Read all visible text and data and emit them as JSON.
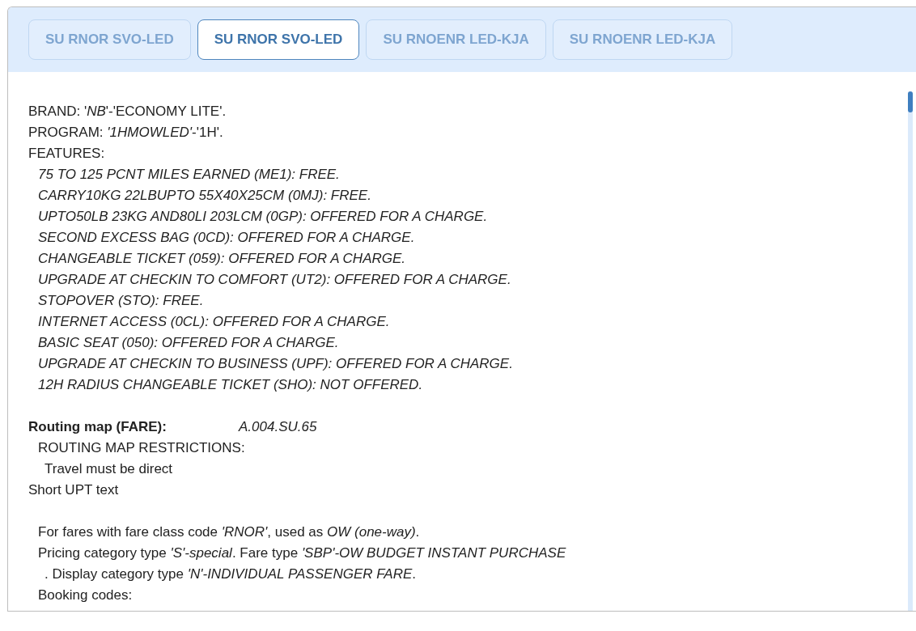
{
  "tabs": [
    {
      "label": "SU RNOR SVO-LED",
      "selected": false
    },
    {
      "label": "SU RNOR SVO-LED",
      "selected": true
    },
    {
      "label": "SU RNOENR LED-KJA",
      "selected": false
    },
    {
      "label": "SU RNOENR LED-KJA",
      "selected": false
    }
  ],
  "sections": [
    {
      "lines": [
        {
          "kind": "top",
          "text": "BRAND: '*NB*'-'ECONOMY LITE'."
        },
        {
          "kind": "top",
          "text": "PROGRAM: *'1HMOWLED'*-'1H'."
        },
        {
          "kind": "top",
          "text": "FEATURES:"
        },
        {
          "kind": "feature",
          "text": "75 TO 125 PCNT MILES EARNED (ME1): FREE."
        },
        {
          "kind": "feature",
          "text": "CARRY10KG 22LBUPTO 55X40X25CM (0MJ): FREE."
        },
        {
          "kind": "feature",
          "text": "UPTO50LB 23KG AND80LI 203LCM (0GP): OFFERED FOR A CHARGE."
        },
        {
          "kind": "feature",
          "text": "SECOND EXCESS BAG (0CD): OFFERED FOR A CHARGE."
        },
        {
          "kind": "feature",
          "text": "CHANGEABLE TICKET (059): OFFERED FOR A CHARGE."
        },
        {
          "kind": "feature",
          "text": "UPGRADE AT CHECKIN TO COMFORT (UT2): OFFERED FOR A CHARGE."
        },
        {
          "kind": "feature",
          "text": "STOPOVER (STO): FREE."
        },
        {
          "kind": "feature",
          "text": "INTERNET ACCESS (0CL): OFFERED FOR A CHARGE."
        },
        {
          "kind": "feature",
          "text": "BASIC SEAT (050): OFFERED FOR A CHARGE."
        },
        {
          "kind": "feature",
          "text": "UPGRADE AT CHECKIN TO BUSINESS (UPF): OFFERED FOR A CHARGE."
        },
        {
          "kind": "feature",
          "text": "12H RADIUS CHANGEABLE TICKET (SHO): NOT OFFERED."
        }
      ]
    },
    {
      "lines": [
        {
          "kind": "heading",
          "label": "Routing map (FARE):",
          "value": "A.004.SU.65"
        },
        {
          "kind": "sub",
          "text": "ROUTING MAP RESTRICTIONS:"
        },
        {
          "kind": "subsub",
          "text": "Travel must be direct"
        },
        {
          "kind": "top",
          "text": "Short UPT text"
        }
      ]
    },
    {
      "lines": [
        {
          "kind": "sub",
          "text": "For fares with fare class code *'RNOR'*, used as *OW (one-way)*."
        },
        {
          "kind": "sub",
          "text": "Pricing category type *'S'-special*. Fare type *'SBP'-OW BUDGET INSTANT PURCHASE*"
        },
        {
          "kind": "subsub",
          "text": ". Display category type *'N'-INDIVIDUAL PASSENGER FARE*."
        },
        {
          "kind": "sub",
          "text": "Booking codes:"
        }
      ]
    }
  ]
}
